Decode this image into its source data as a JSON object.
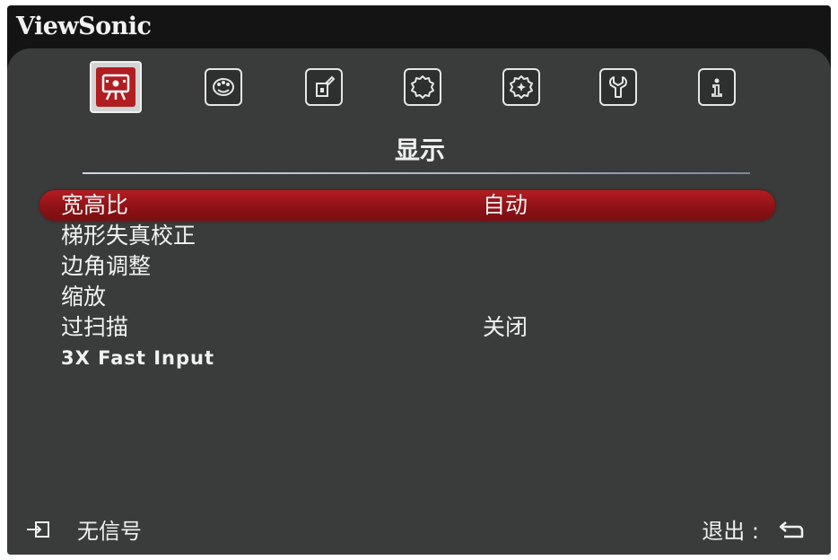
{
  "brand": "ViewSonic",
  "tabs": [
    {
      "icon": "display-icon",
      "active": true
    },
    {
      "icon": "palette-icon",
      "active": false
    },
    {
      "icon": "power-settings-icon",
      "active": false
    },
    {
      "icon": "gear-icon",
      "active": false
    },
    {
      "icon": "advanced-gear-icon",
      "active": false
    },
    {
      "icon": "wrench-icon",
      "active": false
    },
    {
      "icon": "info-icon",
      "active": false
    }
  ],
  "active_tab_title": "显示",
  "menu": [
    {
      "label": "宽高比",
      "value": "自动",
      "selected": true
    },
    {
      "label": "梯形失真校正",
      "value": ""
    },
    {
      "label": "边角调整",
      "value": ""
    },
    {
      "label": "缩放",
      "value": ""
    },
    {
      "label": "过扫描",
      "value": "关闭"
    },
    {
      "label": "3X Fast Input",
      "value": ""
    }
  ],
  "footer": {
    "source_icon": "input-source-icon",
    "source_status": "无信号",
    "exit_label": "退出 :",
    "back_icon": "return-arrow-icon"
  },
  "colors": {
    "accent": "#b01e22",
    "panel": "#3a3b3b",
    "frame": "#141414",
    "text": "#f2f2f2"
  }
}
